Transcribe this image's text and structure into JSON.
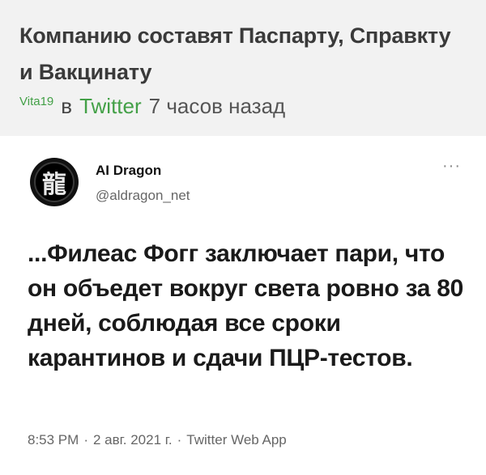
{
  "post": {
    "title": "Компанию составят Паспарту, Справкту и Вакцинату",
    "author": "Vita19",
    "in_label": "в",
    "platform": "Twitter",
    "time_ago": "7 часов назад"
  },
  "tweet": {
    "avatar_glyph": "龍",
    "display_name": "AI Dragon",
    "handle": "@aldragon_net",
    "more_icon": "more-horizontal-icon",
    "text": "...Филеас Фогг заключает пари, что он объедет вокруг света ровно за 80 дней, соблюдая все сроки карантинов и сдачи ПЦР-тестов.",
    "time": "8:53 PM",
    "date": "2 авг. 2021 г.",
    "source": "Twitter Web App",
    "separator": "·"
  },
  "colors": {
    "accent_green": "#43a047",
    "page_background": "#f2f2f2",
    "card_background": "#ffffff"
  }
}
